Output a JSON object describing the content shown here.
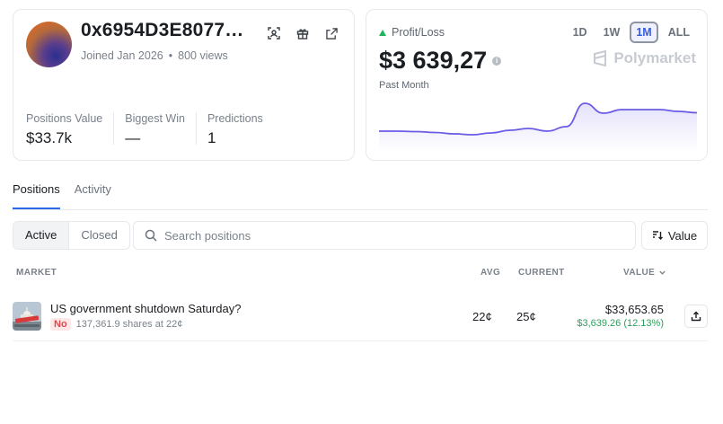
{
  "profile": {
    "username": "0x6954D3E80774...",
    "joined": "Joined Jan 2026",
    "separator": "•",
    "views": "800 views",
    "icons": [
      "scan-icon",
      "gift-icon",
      "external-link-icon"
    ],
    "stats": [
      {
        "label": "Positions Value",
        "value": "$33.7k"
      },
      {
        "label": "Biggest Win",
        "value": "—"
      },
      {
        "label": "Predictions",
        "value": "1"
      }
    ]
  },
  "pnl": {
    "label": "Profit/Loss",
    "value": "$3 639,27",
    "info_glyph": "i",
    "period": "Past Month",
    "ranges": [
      "1D",
      "1W",
      "1M",
      "ALL"
    ],
    "active_range": "1M",
    "brand": "Polymarket",
    "colors": {
      "up": "#21b35b",
      "line": "#6b5ce6"
    },
    "chart_series": [
      0.38,
      0.38,
      0.37,
      0.35,
      0.32,
      0.3,
      0.34,
      0.4,
      0.44,
      0.38,
      0.48,
      1.0,
      0.78,
      0.86,
      0.86,
      0.86,
      0.82,
      0.79
    ]
  },
  "tabs": [
    {
      "label": "Positions",
      "active": true
    },
    {
      "label": "Activity",
      "active": false
    }
  ],
  "filters": {
    "active_label": "Active",
    "closed_label": "Closed",
    "search_placeholder": "Search positions",
    "sort_label": "Value"
  },
  "table": {
    "headers": {
      "market": "MARKET",
      "avg": "AVG",
      "current": "CURRENT",
      "value": "VALUE"
    },
    "rows": [
      {
        "title": "US government shutdown Saturday?",
        "outcome": "No",
        "shares": "137,361.9 shares at 22¢",
        "avg": "22¢",
        "current": "25¢",
        "value": "$33,653.65",
        "pnl": "$3,639.26 (12.13%)"
      }
    ]
  }
}
